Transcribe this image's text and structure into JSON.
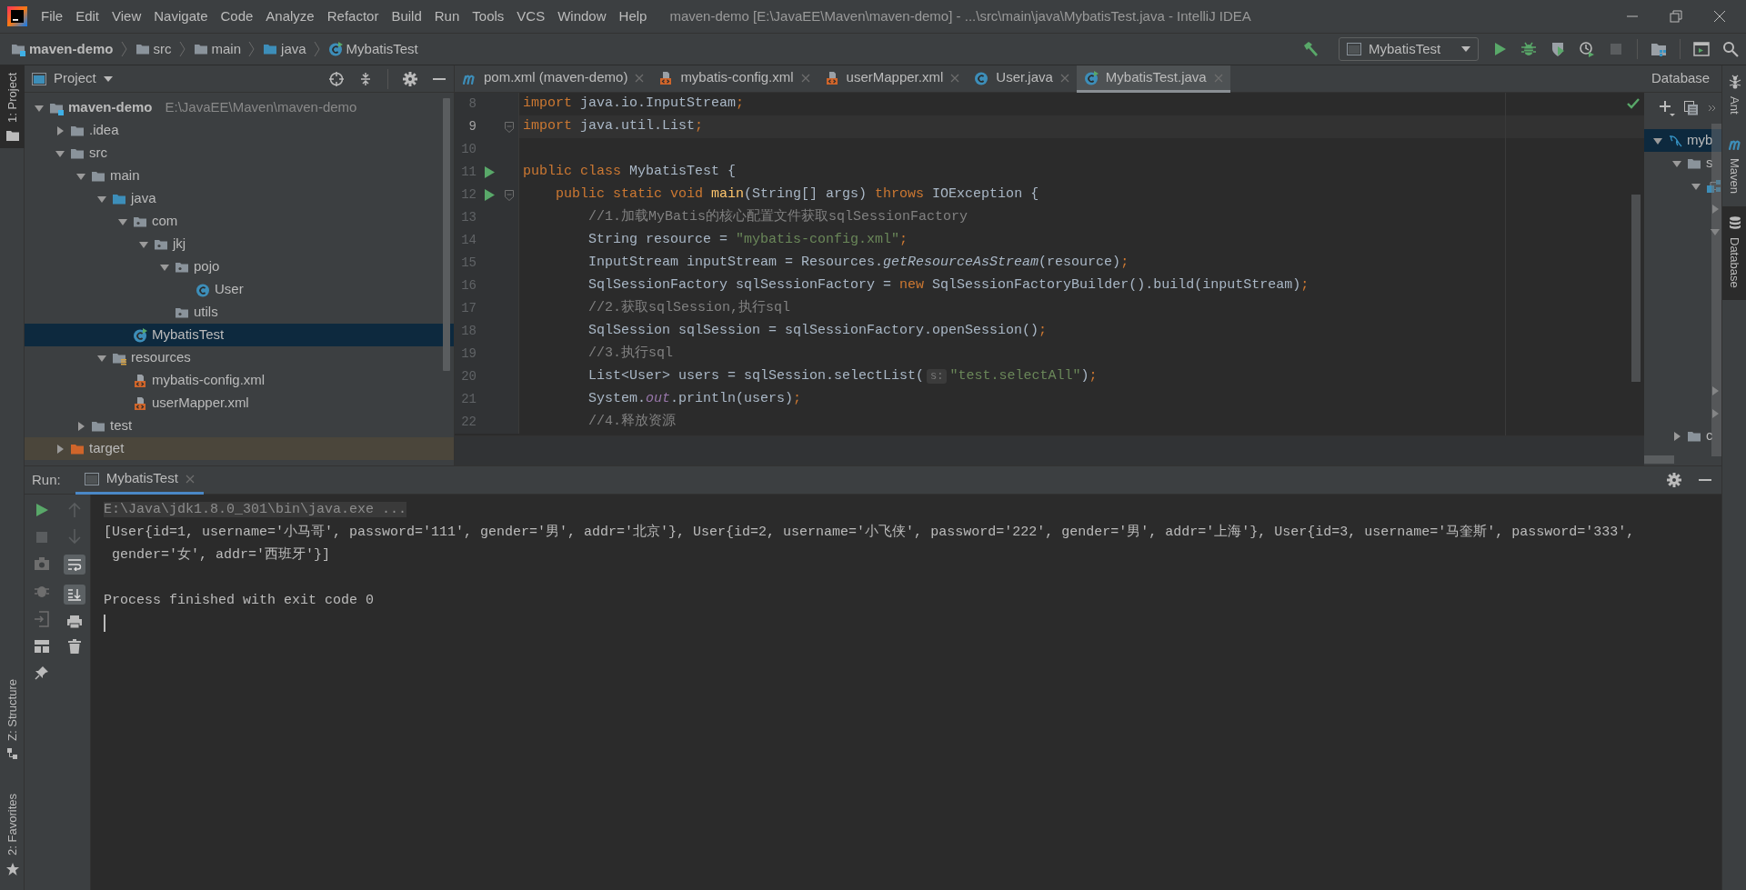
{
  "title_bar": {
    "menu": [
      {
        "label": "File"
      },
      {
        "label": "Edit"
      },
      {
        "label": "View"
      },
      {
        "label": "Navigate"
      },
      {
        "label": "Code"
      },
      {
        "label": "Analyze"
      },
      {
        "label": "Refactor"
      },
      {
        "label": "Build"
      },
      {
        "label": "Run"
      },
      {
        "label": "Tools"
      },
      {
        "label": "VCS"
      },
      {
        "label": "Window"
      },
      {
        "label": "Help"
      }
    ],
    "title": "maven-demo [E:\\JavaEE\\Maven\\maven-demo] - ...\\src\\main\\java\\MybatisTest.java - IntelliJ IDEA"
  },
  "breadcrumbs": [
    {
      "label": "maven-demo",
      "kind": "module"
    },
    {
      "label": "src",
      "kind": "folder"
    },
    {
      "label": "main",
      "kind": "folder"
    },
    {
      "label": "java",
      "kind": "source-folder"
    },
    {
      "label": "MybatisTest",
      "kind": "runnable-class"
    }
  ],
  "run_configuration": {
    "label": "MybatisTest"
  },
  "left_stripe": {
    "top": [
      {
        "label": "1: Project",
        "selected": true
      }
    ],
    "bottom": [
      {
        "label": "Z: Structure",
        "selected": false
      },
      {
        "label": "2: Favorites",
        "selected": false
      }
    ]
  },
  "right_stripe": [
    {
      "label": "Ant",
      "kind": "ant",
      "selected": false
    },
    {
      "label": "Maven",
      "kind": "maven",
      "selected": false
    },
    {
      "label": "Database",
      "kind": "database",
      "selected": true
    }
  ],
  "project_panel": {
    "title": "Project",
    "tree": [
      {
        "label": "maven-demo",
        "kind": "module",
        "path": "E:\\JavaEE\\Maven\\maven-demo",
        "expanded": true,
        "selected": false,
        "children": [
          {
            "label": ".idea",
            "kind": "folder",
            "expanded": false,
            "selected": false
          },
          {
            "label": "src",
            "kind": "folder",
            "expanded": true,
            "selected": false,
            "children": [
              {
                "label": "main",
                "kind": "folder",
                "expanded": true,
                "selected": false,
                "children": [
                  {
                    "label": "java",
                    "kind": "source-folder",
                    "expanded": true,
                    "selected": false,
                    "children": [
                      {
                        "label": "com",
                        "kind": "package",
                        "expanded": true,
                        "selected": false,
                        "children": [
                          {
                            "label": "jkj",
                            "kind": "package",
                            "expanded": true,
                            "selected": false,
                            "children": [
                              {
                                "label": "pojo",
                                "kind": "package",
                                "expanded": true,
                                "selected": false,
                                "children": [
                                  {
                                    "label": "User",
                                    "kind": "class",
                                    "selected": false
                                  }
                                ]
                              },
                              {
                                "label": "utils",
                                "kind": "package",
                                "selected": false
                              }
                            ]
                          }
                        ]
                      },
                      {
                        "label": "MybatisTest",
                        "kind": "runnable-class",
                        "selected": true
                      }
                    ]
                  },
                  {
                    "label": "resources",
                    "kind": "resources",
                    "expanded": true,
                    "selected": false,
                    "children": [
                      {
                        "label": "mybatis-config.xml",
                        "kind": "xml",
                        "selected": false
                      },
                      {
                        "label": "userMapper.xml",
                        "kind": "xml",
                        "selected": false
                      }
                    ]
                  }
                ]
              },
              {
                "label": "test",
                "kind": "folder",
                "expanded": false,
                "selected": false
              }
            ]
          },
          {
            "label": "target",
            "kind": "excluded-folder",
            "expanded": false,
            "selected": false
          }
        ]
      }
    ]
  },
  "editor_tabs": [
    {
      "label": "pom.xml (maven-demo)",
      "kind": "maven",
      "selected": false
    },
    {
      "label": "mybatis-config.xml",
      "kind": "xml",
      "selected": false
    },
    {
      "label": "userMapper.xml",
      "kind": "xml",
      "selected": false
    },
    {
      "label": "User.java",
      "kind": "class",
      "selected": false
    },
    {
      "label": "MybatisTest.java",
      "kind": "runnable-class",
      "selected": true
    }
  ],
  "code_lines": [
    {
      "number": "8",
      "current": false,
      "run": false,
      "fold": false,
      "tokens": [
        {
          "kind": "keyword",
          "text": "import"
        },
        {
          "kind": "plain",
          "text": " java.io.InputStream"
        },
        {
          "kind": "keyword",
          "text": ";"
        }
      ]
    },
    {
      "number": "9",
      "current": true,
      "run": false,
      "fold": true,
      "tokens": [
        {
          "kind": "keyword",
          "text": "import"
        },
        {
          "kind": "plain",
          "text": " java.util.List"
        },
        {
          "kind": "keyword",
          "text": ";"
        }
      ]
    },
    {
      "number": "10",
      "current": false,
      "run": false,
      "fold": false
    },
    {
      "number": "11",
      "current": false,
      "run": true,
      "fold": false,
      "tokens": [
        {
          "kind": "keyword",
          "text": "public class"
        },
        {
          "kind": "plain",
          "text": " MybatisTest {"
        }
      ]
    },
    {
      "number": "12",
      "current": false,
      "run": true,
      "fold": true,
      "tokens": [
        {
          "kind": "keyword",
          "text": "    public static void "
        },
        {
          "kind": "method",
          "text": "main"
        },
        {
          "kind": "plain",
          "text": "(String[] args) "
        },
        {
          "kind": "keyword",
          "text": "throws"
        },
        {
          "kind": "plain",
          "text": " IOException {"
        }
      ]
    },
    {
      "number": "13",
      "current": false,
      "run": false,
      "fold": false,
      "tokens": [
        {
          "kind": "comment",
          "text": "        //1.加载MyBatis的核心配置文件获取sqlSessionFactory"
        }
      ]
    },
    {
      "number": "14",
      "current": false,
      "run": false,
      "fold": false,
      "tokens": [
        {
          "kind": "plain",
          "text": "        String resource = "
        },
        {
          "kind": "string",
          "text": "\"mybatis-config.xml\""
        },
        {
          "kind": "keyword",
          "text": ";"
        }
      ]
    },
    {
      "number": "15",
      "current": false,
      "run": false,
      "fold": false,
      "tokens": [
        {
          "kind": "plain",
          "text": "        InputStream inputStream = Resources."
        },
        {
          "kind": "static-method",
          "text": "getResourceAsStream"
        },
        {
          "kind": "plain",
          "text": "(resource)"
        },
        {
          "kind": "keyword",
          "text": ";"
        }
      ]
    },
    {
      "number": "16",
      "current": false,
      "run": false,
      "fold": false,
      "tokens": [
        {
          "kind": "plain",
          "text": "        SqlSessionFactory sqlSessionFactory = "
        },
        {
          "kind": "keyword",
          "text": "new"
        },
        {
          "kind": "plain",
          "text": " SqlSessionFactoryBuilder().build(inputStream)"
        },
        {
          "kind": "keyword",
          "text": ";"
        }
      ]
    },
    {
      "number": "17",
      "current": false,
      "run": false,
      "fold": false,
      "tokens": [
        {
          "kind": "comment",
          "text": "        //2.获取sqlSession,执行sql"
        }
      ]
    },
    {
      "number": "18",
      "current": false,
      "run": false,
      "fold": false,
      "tokens": [
        {
          "kind": "plain",
          "text": "        SqlSession sqlSession = sqlSessionFactory.openSession()"
        },
        {
          "kind": "keyword",
          "text": ";"
        }
      ]
    },
    {
      "number": "19",
      "current": false,
      "run": false,
      "fold": false,
      "tokens": [
        {
          "kind": "comment",
          "text": "        //3.执行sql"
        }
      ]
    },
    {
      "number": "20",
      "current": false,
      "run": false,
      "fold": false,
      "tokens": [
        {
          "kind": "plain",
          "text": "        List<User> users = sqlSession.selectList("
        },
        {
          "kind": "hint",
          "text": "s:"
        },
        {
          "kind": "string",
          "text": "\"test.selectAll\""
        },
        {
          "kind": "plain",
          "text": ")"
        },
        {
          "kind": "keyword",
          "text": ";"
        }
      ]
    },
    {
      "number": "21",
      "current": false,
      "run": false,
      "fold": false,
      "tokens": [
        {
          "kind": "plain",
          "text": "        System."
        },
        {
          "kind": "static-field",
          "text": "out"
        },
        {
          "kind": "plain",
          "text": ".println(users)"
        },
        {
          "kind": "keyword",
          "text": ";"
        }
      ]
    },
    {
      "number": "22",
      "current": false,
      "run": false,
      "fold": false,
      "tokens": [
        {
          "kind": "comment",
          "text": "        //4.释放资源"
        }
      ]
    }
  ],
  "database_panel": {
    "title": "Database",
    "tree": [
      {
        "label": "myb",
        "kind": "mysql",
        "expanded": true,
        "selected": true,
        "children": [
          {
            "label": "s",
            "kind": "folder",
            "expanded": true,
            "selected": false,
            "children": [
              {
                "kind": "schema",
                "expanded": true,
                "selected": false,
                "children": [
                  {
                    "expanded": false,
                    "selected": false
                  },
                  {
                    "expanded": true,
                    "selected": false
                  },
                  {
                    "expanded": false,
                    "selected": false
                  },
                  {
                    "expanded": false,
                    "selected": false
                  }
                ]
              }
            ]
          },
          {
            "label": "c",
            "kind": "folder",
            "expanded": false,
            "selected": false
          }
        ]
      }
    ]
  },
  "run_panel": {
    "label": "Run:",
    "tabs": [
      {
        "label": "MybatisTest",
        "selected": true
      }
    ],
    "stop_enabled": false,
    "soft_wrap_on": true,
    "scroll_to_end_on": true,
    "console": [
      {
        "kind": "command",
        "text": "E:\\Java\\jdk1.8.0_301\\bin\\java.exe ..."
      },
      {
        "kind": "output",
        "text": "[User{id=1, username='小马哥', password='111', gender='男', addr='北京'}, User{id=2, username='小飞侠', password='222', gender='男', addr='上海'}, User{id=3, username='马奎斯', password='333',"
      },
      {
        "kind": "output",
        "text": " gender='女', addr='西班牙'}]"
      },
      {
        "kind": "blank"
      },
      {
        "kind": "output",
        "text": "Process finished with exit code 0"
      }
    ]
  }
}
